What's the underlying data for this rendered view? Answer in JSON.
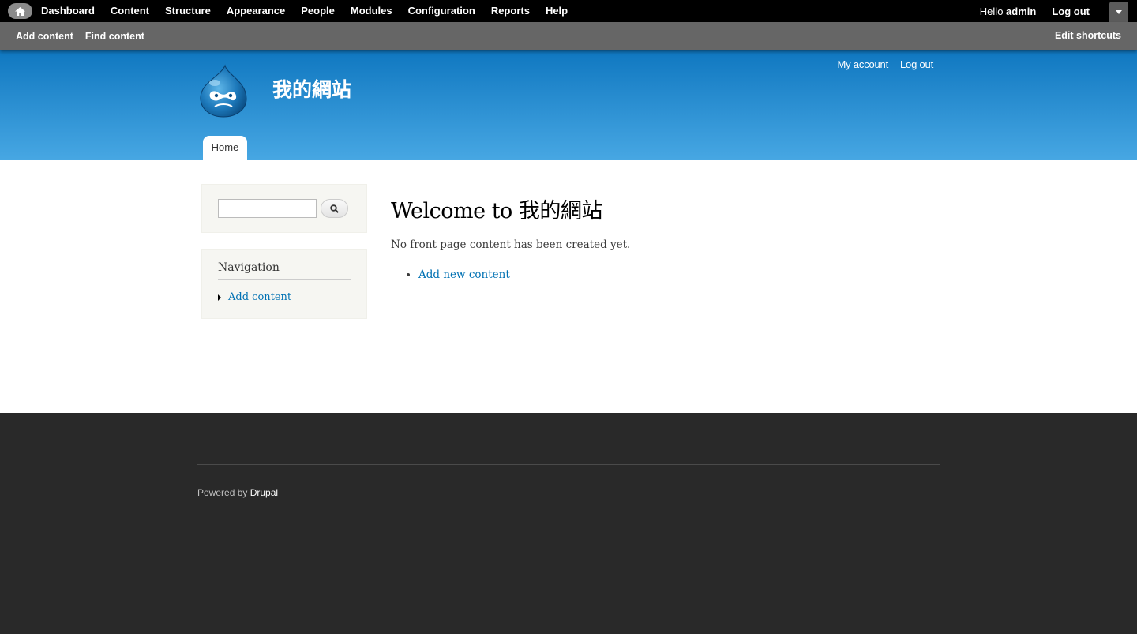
{
  "toolbar": {
    "menu": [
      "Dashboard",
      "Content",
      "Structure",
      "Appearance",
      "People",
      "Modules",
      "Configuration",
      "Reports",
      "Help"
    ],
    "hello_prefix": "Hello ",
    "username": "admin",
    "logout": "Log out",
    "shortcuts": [
      "Add content",
      "Find content"
    ],
    "edit_shortcuts": "Edit shortcuts"
  },
  "header": {
    "site_name": "我的網站",
    "secondary_menu": [
      "My account",
      "Log out"
    ],
    "tab_home": "Home"
  },
  "sidebar": {
    "navigation_title": "Navigation",
    "navigation_item": "Add content"
  },
  "content": {
    "title": "Welcome to 我的網站",
    "message": "No front page content has been created yet.",
    "link": "Add new content"
  },
  "footer": {
    "powered_by": "Powered by ",
    "drupal": "Drupal"
  },
  "colors": {
    "header_top": "#0f77c0",
    "header_bottom": "#47a7e3",
    "link": "#0071b3",
    "footer_bg": "#292929"
  }
}
